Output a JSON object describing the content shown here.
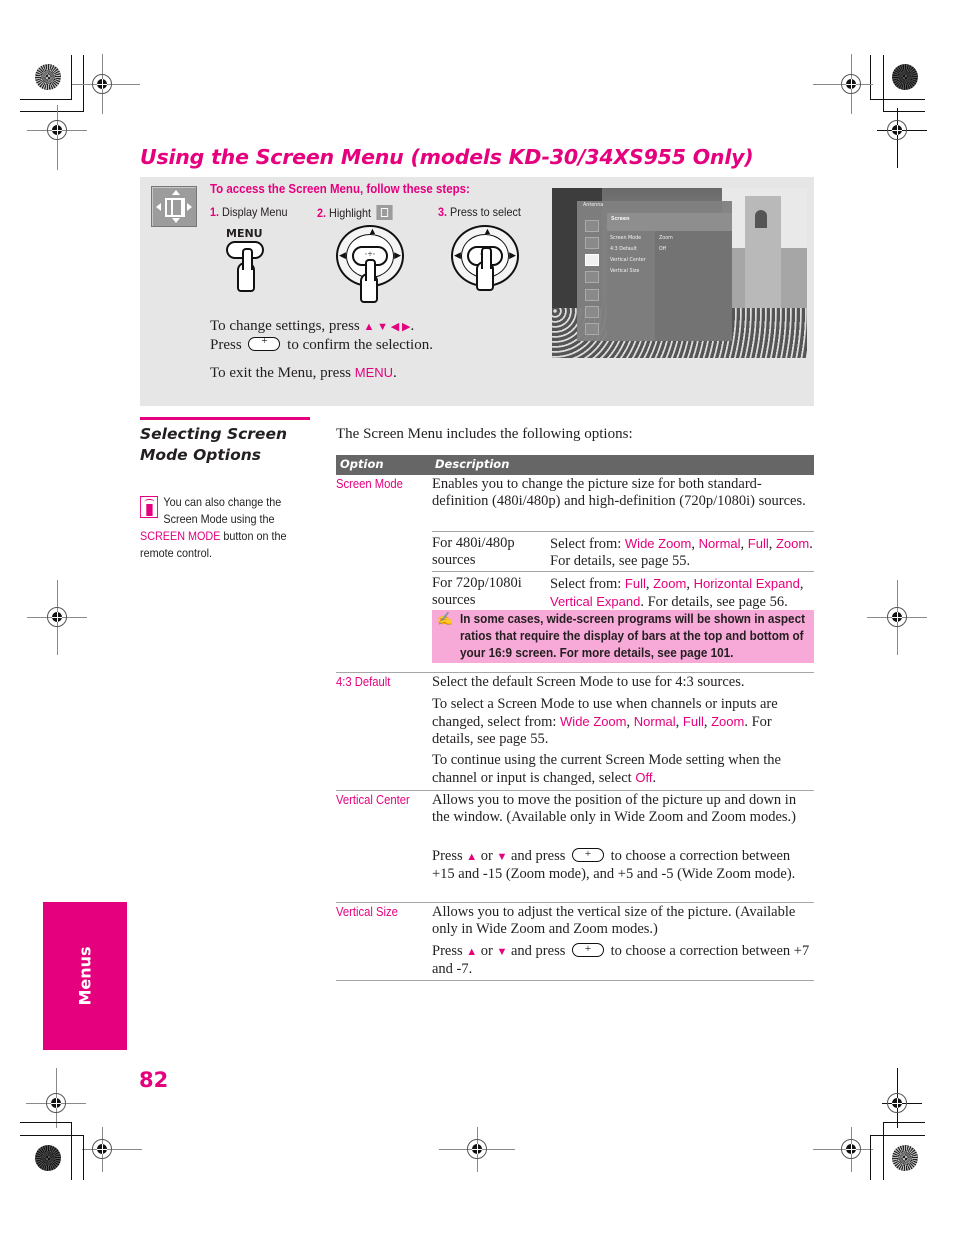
{
  "page": {
    "title": "Using the Screen Menu (models KD-30/34XS955 Only)",
    "page_number": "82",
    "side_tab": "Menus",
    "accent_color": "#e5007e",
    "note_bg_color": "#f7a9d7"
  },
  "steps_panel": {
    "heading": "To access the Screen Menu, follow these steps:",
    "steps": [
      {
        "num": "1.",
        "label": "Display Menu",
        "button": "MENU"
      },
      {
        "num": "2.",
        "label": "Highlight",
        "icon": "screen-menu-icon"
      },
      {
        "num": "3.",
        "label": "Press to select"
      }
    ],
    "change_settings": "To change settings, press",
    "arrows": "↑ ↓ ← →",
    "press": "Press",
    "confirm": "to confirm the selection.",
    "exit_prefix": "To exit the Menu, press",
    "exit_key": "MENU",
    "exit_suffix": "."
  },
  "tv_osd": {
    "source": "Antenna",
    "menu_title": "Screen",
    "items": [
      {
        "label": "Screen Mode",
        "value": "Zoom"
      },
      {
        "label": "4:3 Default",
        "value": "Off"
      },
      {
        "label": "Vertical Center",
        "value": ""
      },
      {
        "label": "Vertical Size",
        "value": ""
      }
    ],
    "side_icons": [
      "picture-icon",
      "sound-icon",
      "screen-icon",
      "channel-icon",
      "parent-lock-icon",
      "setup-icon",
      "applications-icon"
    ]
  },
  "section": {
    "title_line1": "Selecting Screen",
    "title_line2": "Mode Options",
    "tip_text1": "You can also change the Screen Mode using the",
    "tip_key": "SCREEN MODE",
    "tip_text2": "button on the remote control."
  },
  "table": {
    "intro": "The Screen Menu includes the following options:",
    "headers": {
      "option": "Option",
      "description": "Description"
    },
    "rows": [
      {
        "option": "Screen Mode",
        "desc": "Enables you to change the picture size for both standard-definition (480i/480p) and high-definition (720p/1080i) sources.",
        "sub": [
          {
            "source": "For 480i/480p sources",
            "pre": "Select from:",
            "opts": [
              "Wide Zoom",
              "Normal",
              "Full",
              "Zoom"
            ],
            "post": "For details, see page 55."
          },
          {
            "source": "For 720p/1080i sources",
            "pre": "Select from:",
            "opts": [
              "Full",
              "Zoom",
              "Horizontal Expand",
              "Vertical Expand"
            ],
            "post": "For details, see page 56."
          }
        ],
        "note": "In some cases, wide-screen programs will be shown in aspect ratios that require the display of bars at the top and bottom of your 16:9 screen. For more details, see page 101."
      },
      {
        "option": "4:3 Default",
        "desc1": "Select the default Screen Mode to use for 4:3 sources.",
        "desc2_pre": "To select a Screen Mode to use when channels or inputs are changed, select from:",
        "desc2_opts": [
          "Wide Zoom",
          "Normal",
          "Full",
          "Zoom"
        ],
        "desc2_post": "For details, see page 55.",
        "desc3_pre": "To continue using the current Screen Mode setting when the channel or input is changed, select",
        "desc3_key": "Off",
        "desc3_post": "."
      },
      {
        "option": "Vertical Center",
        "desc1": "Allows you to move the position of the picture up and down in the window. (Available only in Wide Zoom and Zoom modes.)",
        "press": "Press",
        "or": "or",
        "and_press": "and press",
        "desc2_post": "to choose a correction between +15 and -15 (Zoom mode), and +5 and -5 (Wide Zoom mode)."
      },
      {
        "option": "Vertical Size",
        "desc1": "Allows you to adjust the vertical size of the picture. (Available only in Wide Zoom and Zoom modes.)",
        "press": "Press",
        "or": "or",
        "and_press": "and press",
        "desc2_post": "to choose a correction between +7 and -7."
      }
    ]
  }
}
